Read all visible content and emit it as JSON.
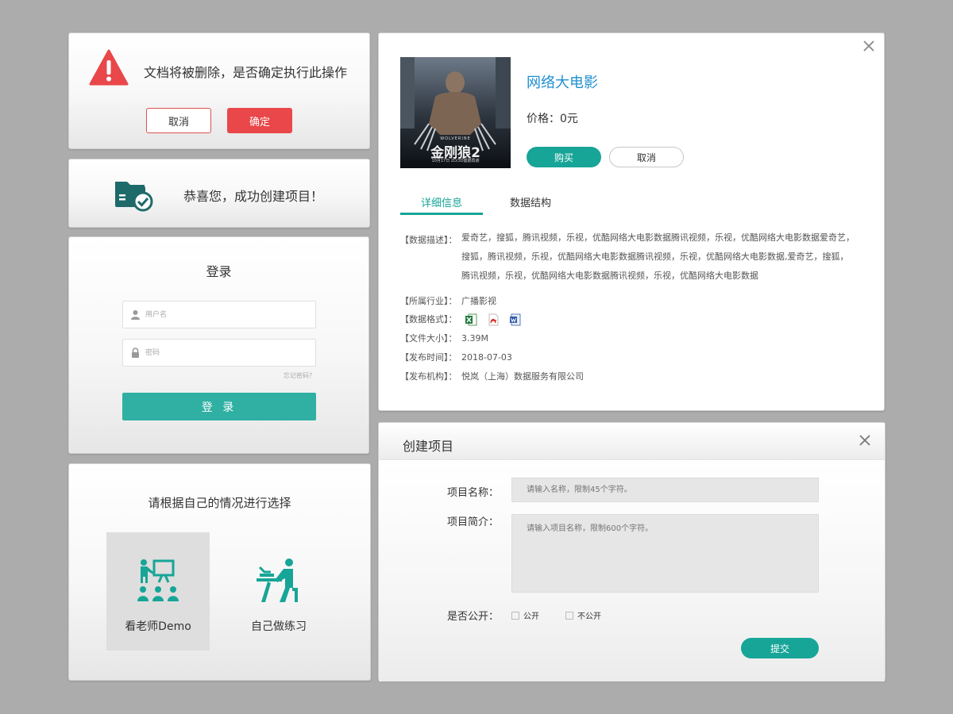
{
  "confirm_dialog": {
    "message": "文档将被删除，是否确定执行此操作",
    "cancel_label": "取消",
    "ok_label": "确定",
    "accent": "#e9474a"
  },
  "success_dialog": {
    "message": "恭喜您，成功创建项目！",
    "icon": "folder-check-icon",
    "accent": "#1e6a6a"
  },
  "login": {
    "title": "登录",
    "username_placeholder": "用户名",
    "password_placeholder": "密码",
    "forgot_link": "忘记密码？",
    "submit_label": "登 录",
    "accent": "#2fb0a3"
  },
  "choose": {
    "title": "请根据自己的情况进行选择",
    "options": [
      {
        "label": "看老师Demo",
        "icon": "teacher-presentation-icon",
        "selected": true
      },
      {
        "label": "自己做练习",
        "icon": "self-study-desk-icon",
        "selected": false
      }
    ]
  },
  "product": {
    "title": "网络大电影",
    "price": "价格：0元",
    "buy_label": "购买",
    "cancel_label": "取消",
    "poster": {
      "brand": "WOLVERINE",
      "title": "金刚狼2",
      "subtitle": "10月17日 2D/3D震撼再袭"
    },
    "tabs": [
      {
        "label": "详细信息",
        "active": true
      },
      {
        "label": "数据结构",
        "active": false
      }
    ],
    "details": {
      "desc_key": "【数据描述】：",
      "desc_lines": [
        "爱奇艺，搜狐，腾讯视频，乐视，优酷网络大电影数据腾讯视频，乐视，优酷网络大电影数据爱奇艺，",
        "搜狐，腾讯视频，乐视，优酷网络大电影数据腾讯视频，乐视，优酷网络大电影数据,爱奇艺，搜狐，",
        "腾讯视频，乐视，优酷网络大电影数据腾讯视频，乐视，优酷网络大电影数据"
      ],
      "industry_key": "【所属行业】：",
      "industry": "广播影视",
      "format_key": "【数据格式】：",
      "formats": [
        "excel-icon",
        "pdf-icon",
        "word-icon"
      ],
      "size_key": "【文件大小】：",
      "size": "3.39M",
      "date_key": "【发布时间】：",
      "date": "2018-07-03",
      "org_key": "【发布机构】：",
      "org": "悦岚（上海）数据服务有限公司"
    },
    "accent": "#17a597",
    "title_color": "#1f8fd0"
  },
  "create_project": {
    "title": "创建项目",
    "name_label": "项目名称：",
    "name_placeholder": "请输入名称，限制45个字符。",
    "intro_label": "项目简介：",
    "intro_placeholder": "请输入项目名称，限制600个字符。",
    "public_label": "是否公开：",
    "public_option": "公开",
    "private_option": "不公开",
    "submit_label": "提交"
  }
}
